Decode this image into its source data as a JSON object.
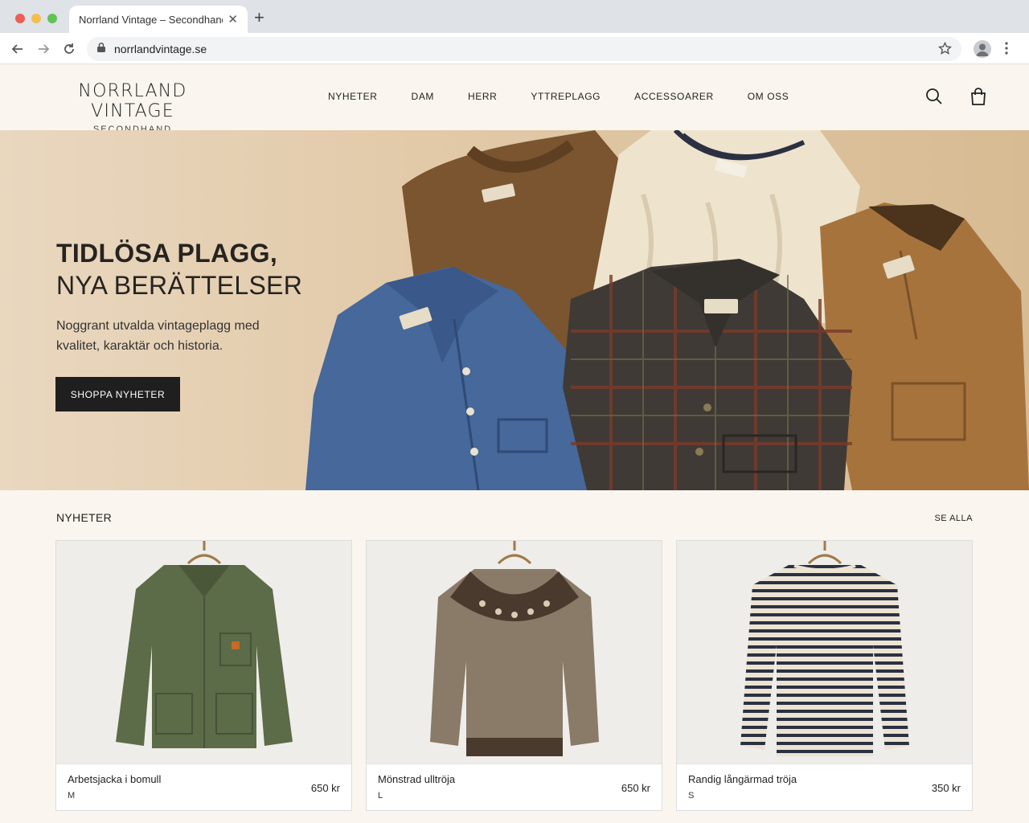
{
  "browser": {
    "tab_title": "Norrland Vintage – Secondhand",
    "url": "norrlandvintage.se",
    "colors": {
      "close": "#ec5f57",
      "minimize": "#f3be4f",
      "maximize": "#5fc355"
    }
  },
  "site": {
    "brand_name": "NORRLAND VINTAGE",
    "brand_sub": "SECONDHAND",
    "nav": [
      "NYHETER",
      "DAM",
      "HERR",
      "YTTREPLAGG",
      "ACCESSOARER",
      "OM OSS"
    ],
    "icons": [
      "search-icon",
      "shopping-bag-icon"
    ]
  },
  "hero": {
    "title_line1": "TIDLÖSA PLAGG,",
    "title_line2": "NYA BERÄTTELSER",
    "lead": "Noggrant utvalda vintageplagg med kvalitet, karaktär och historia.",
    "cta": "SHOPPA NYHETER"
  },
  "products": {
    "section_title": "NYHETER",
    "see_all": "SE ALLA",
    "items": [
      {
        "name": "Arbetsjacka i bomull",
        "size": "M",
        "price": "650 kr"
      },
      {
        "name": "Mönstrad ulltröja",
        "size": "L",
        "price": "650 kr"
      },
      {
        "name": "Randig långärmad tröja",
        "size": "S",
        "price": "350 kr"
      }
    ]
  }
}
